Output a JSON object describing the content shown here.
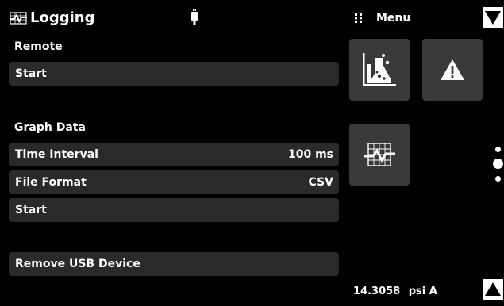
{
  "header": {
    "title": "Logging",
    "menu_label": "Menu"
  },
  "sections": {
    "remote": {
      "label": "Remote",
      "start_label": "Start"
    },
    "graph": {
      "label": "Graph Data",
      "time_interval": {
        "label": "Time Interval",
        "value": "100 ms"
      },
      "file_format": {
        "label": "File Format",
        "value": "CSV"
      },
      "start_label": "Start"
    },
    "remove_usb_label": "Remove USB Device"
  },
  "tiles": [
    "lab-flask-icon",
    "warning-icon",
    "graph-icon"
  ],
  "status": {
    "reading": "14.3058",
    "unit": "psi A"
  },
  "colors": {
    "background": "#000000",
    "row": "#2a2a2a",
    "tile": "#3a3a3a",
    "text": "#ffffff"
  }
}
